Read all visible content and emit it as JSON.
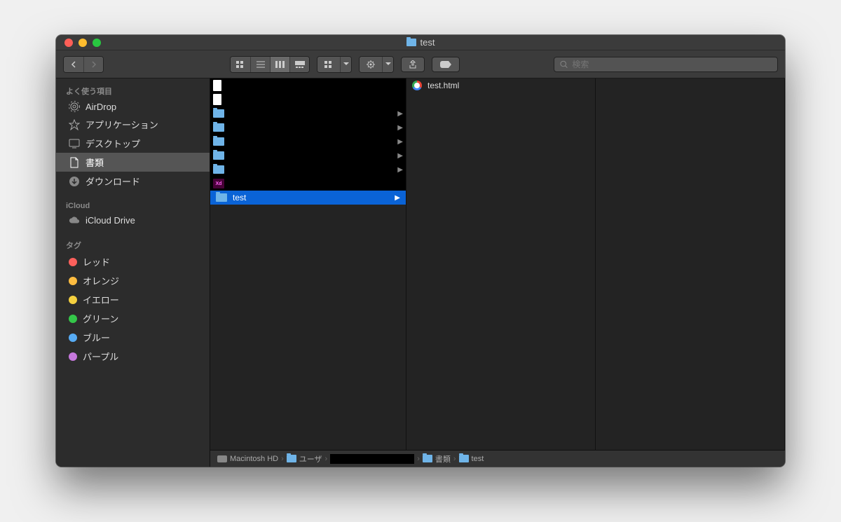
{
  "window": {
    "title": "test"
  },
  "search": {
    "placeholder": "検索"
  },
  "sidebar": {
    "favorites_header": "よく使う項目",
    "favorites": [
      {
        "label": "AirDrop",
        "icon": "airdrop"
      },
      {
        "label": "アプリケーション",
        "icon": "apps"
      },
      {
        "label": "デスクトップ",
        "icon": "desktop"
      },
      {
        "label": "書類",
        "icon": "documents",
        "selected": true
      },
      {
        "label": "ダウンロード",
        "icon": "downloads"
      }
    ],
    "icloud_header": "iCloud",
    "icloud": [
      {
        "label": "iCloud Drive",
        "icon": "cloud"
      }
    ],
    "tags_header": "タグ",
    "tags": [
      {
        "label": "レッド",
        "color": "#fc605c"
      },
      {
        "label": "オレンジ",
        "color": "#fdbc40"
      },
      {
        "label": "イエロー",
        "color": "#f4d03f"
      },
      {
        "label": "グリーン",
        "color": "#34c749"
      },
      {
        "label": "ブルー",
        "color": "#57acf5"
      },
      {
        "label": "パープル",
        "color": "#c678dd"
      }
    ]
  },
  "column1": {
    "redacted_count": 7,
    "xd_label": "Xd",
    "selected": {
      "label": "test"
    }
  },
  "column2": {
    "items": [
      {
        "label": "test.html",
        "icon": "chrome"
      }
    ]
  },
  "pathbar": {
    "segments": [
      {
        "label": "Macintosh HD",
        "icon": "disk"
      },
      {
        "label": "ユーザ",
        "icon": "folder"
      },
      {
        "label": "",
        "redacted": true
      },
      {
        "label": "書類",
        "icon": "folder"
      },
      {
        "label": "test",
        "icon": "folder"
      }
    ]
  }
}
